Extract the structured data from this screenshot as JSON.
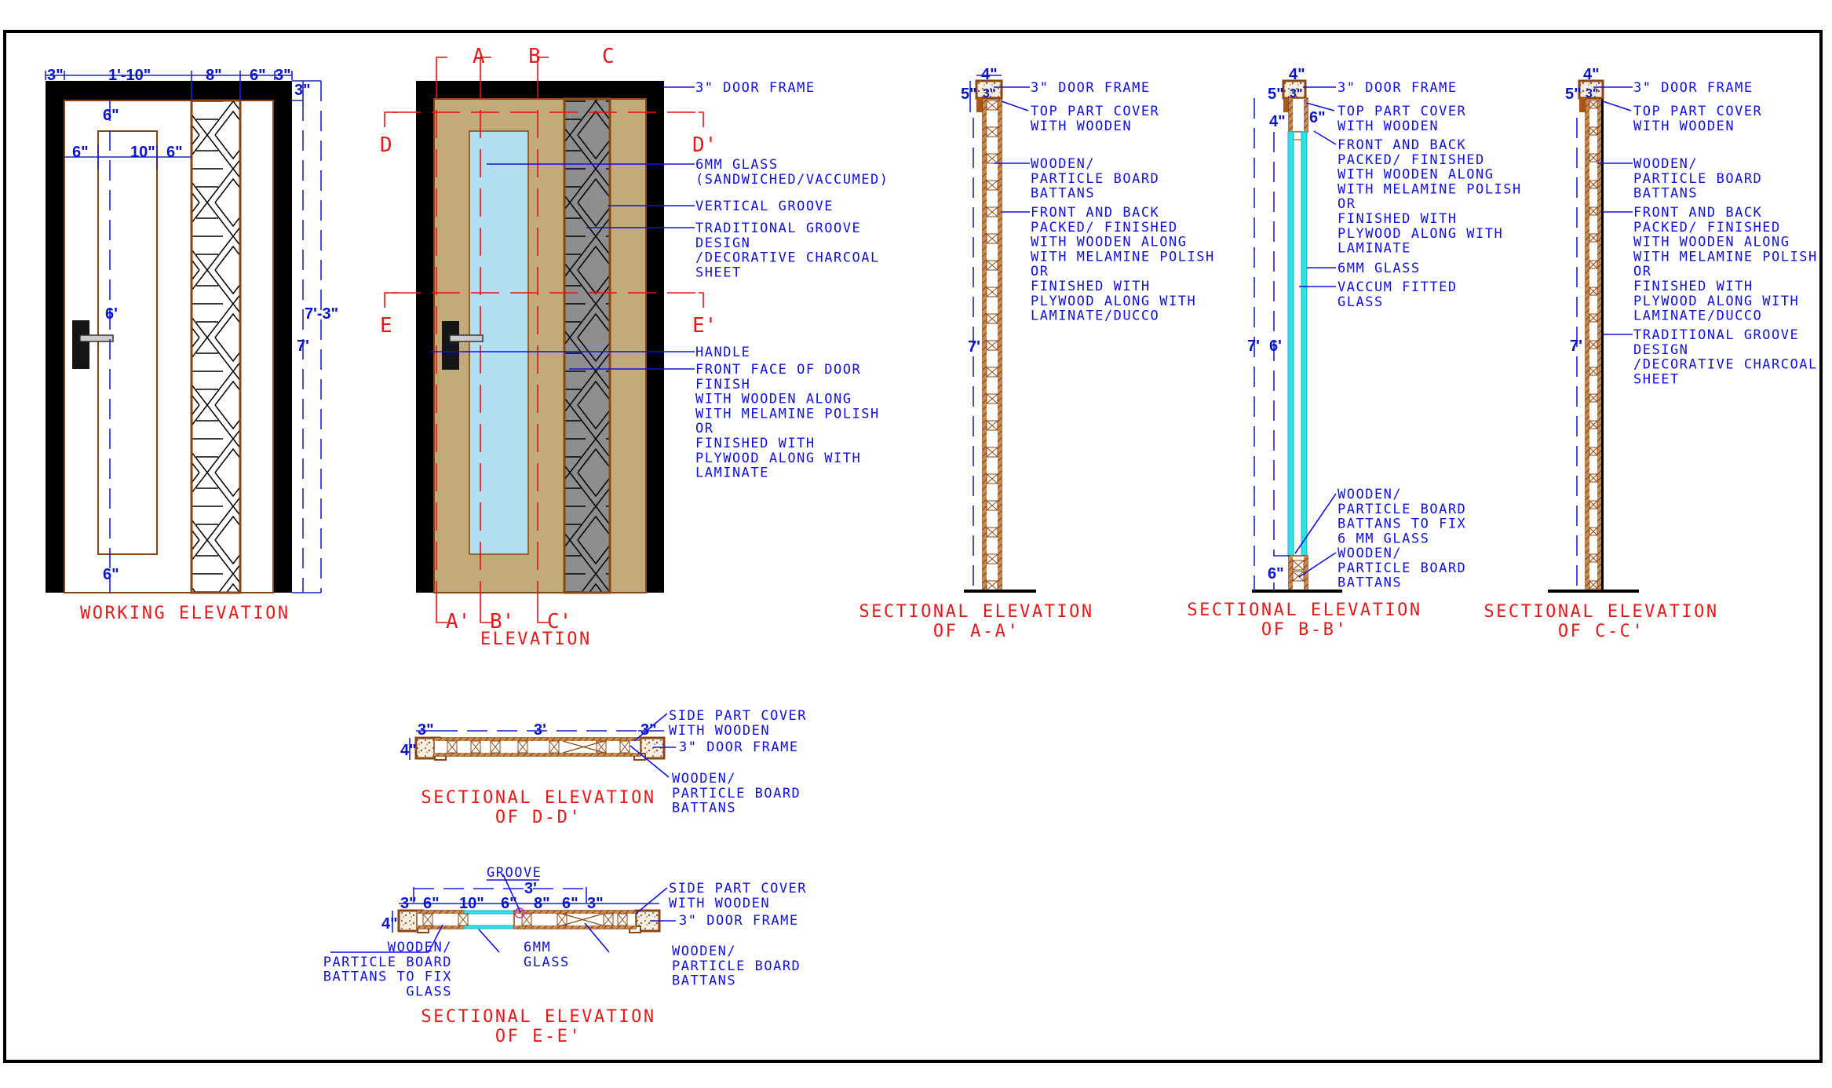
{
  "colors": {
    "frame": "#000000",
    "panel": "#c2ab78",
    "glass": "#b4dff2",
    "charcoal": "#8e8e8e",
    "wood": "#a8561a",
    "section_glass": "#33e0e8",
    "annotation": "#1010e0",
    "title": "#e81818"
  },
  "working_elevation": {
    "title": "WORKING ELEVATION",
    "dims_top": [
      "3\"",
      "1'-10\"",
      "8\"",
      "6\"",
      "3\""
    ],
    "dim_frame_top": "3\"",
    "dim_panel_top": "6\"",
    "dim_panel_row": [
      "6\"",
      "10\"",
      "6\""
    ],
    "dim_panel_height": "6'",
    "dim_panel_bottom": "6\"",
    "dim_overall": "7'-3\"",
    "dim_door": "7'"
  },
  "elevation": {
    "title": "ELEVATION",
    "cut_labels_top": [
      "A",
      "B",
      "C"
    ],
    "cut_labels_bottom": [
      "A'",
      "B'",
      "C'"
    ],
    "cut_labels_left": [
      "D",
      "E"
    ],
    "cut_labels_right": [
      "D'",
      "E'"
    ],
    "notes": {
      "door_frame": [
        "3\" DOOR FRAME"
      ],
      "glass": [
        "6MM GLASS",
        "(SANDWICHED/VACCUMED)"
      ],
      "vertical_groove": [
        "VERTICAL GROOVE"
      ],
      "traditional_groove": [
        "TRADITIONAL GROOVE",
        "DESIGN",
        "/DECORATIVE CHARCOAL",
        "SHEET"
      ],
      "handle": [
        "HANDLE"
      ],
      "front_face": [
        "FRONT FACE OF DOOR",
        "FINISH",
        "WITH WOODEN ALONG",
        "WITH MELAMINE POLISH",
        "OR",
        "FINISHED WITH",
        "PLYWOOD ALONG WITH",
        "LAMINATE"
      ]
    }
  },
  "section_aa": {
    "title": [
      "SECTIONAL ELEVATION",
      "OF A-A'"
    ],
    "dims": {
      "width": "4\"",
      "frame": "3\"",
      "frame_h": "5\"",
      "height": "7'"
    },
    "notes": {
      "door_frame": [
        "3\" DOOR FRAME"
      ],
      "top_cover": [
        "TOP PART COVER",
        "WITH WOODEN"
      ],
      "battans": [
        "WOODEN/",
        "PARTICLE BOARD",
        "BATTANS"
      ],
      "finish": [
        "FRONT AND BACK",
        "PACKED/ FINISHED",
        "WITH WOODEN ALONG",
        "WITH MELAMINE POLISH",
        "OR",
        "FINISHED WITH",
        "PLYWOOD ALONG WITH",
        "LAMINATE/DUCCO"
      ]
    }
  },
  "section_bb": {
    "title": [
      "SECTIONAL ELEVATION",
      "OF B-B'"
    ],
    "dims": {
      "width": "4\"",
      "frame": "3\"",
      "frame_h": "5\"",
      "top_rail": "4\"",
      "top_gap": "6\"",
      "height": "7'",
      "glass_h": "6'",
      "bottom": "6\""
    },
    "notes": {
      "door_frame": [
        "3\" DOOR FRAME"
      ],
      "top_cover": [
        "TOP PART COVER",
        "WITH WOODEN"
      ],
      "finish": [
        "FRONT AND BACK",
        "PACKED/ FINISHED",
        "WITH WOODEN ALONG",
        "WITH MELAMINE POLISH",
        "OR",
        "FINISHED WITH",
        "PLYWOOD ALONG WITH",
        "LAMINATE"
      ],
      "glass": [
        "6MM GLASS"
      ],
      "vacuum": [
        "VACCUM FITTED",
        "GLASS"
      ],
      "battans_fix": [
        "WOODEN/",
        "PARTICLE BOARD",
        "BATTANS TO FIX",
        "6 MM GLASS"
      ],
      "battans": [
        "WOODEN/",
        "PARTICLE BOARD",
        "BATTANS"
      ]
    }
  },
  "section_cc": {
    "title": [
      "SECTIONAL ELEVATION",
      "OF C-C'"
    ],
    "dims": {
      "width": "4\"",
      "frame": "3\"",
      "frame_h": "5\"",
      "height": "7'"
    },
    "notes": {
      "door_frame": [
        "3\" DOOR FRAME"
      ],
      "top_cover": [
        "TOP PART COVER",
        "WITH WOODEN"
      ],
      "battans": [
        "WOODEN/",
        "PARTICLE BOARD",
        "BATTANS"
      ],
      "finish": [
        "FRONT AND BACK",
        "PACKED/ FINISHED",
        "WITH WOODEN ALONG",
        "WITH MELAMINE POLISH",
        "OR",
        "FINISHED WITH",
        "PLYWOOD ALONG WITH",
        "LAMINATE/DUCCO"
      ],
      "groove": [
        "TRADITIONAL GROOVE",
        "DESIGN",
        "/DECORATIVE CHARCOAL",
        "SHEET"
      ]
    }
  },
  "section_dd": {
    "title": [
      "SECTIONAL ELEVATION",
      "OF D-D'"
    ],
    "dims": {
      "left": "3\"",
      "span": "3'",
      "right": "3\"",
      "thickness": "4\""
    },
    "notes": {
      "side_cover": [
        "SIDE PART COVER",
        "WITH WOODEN"
      ],
      "door_frame": [
        "3\" DOOR FRAME"
      ],
      "battans": [
        "WOODEN/",
        "PARTICLE BOARD",
        "BATTANS"
      ]
    }
  },
  "section_ee": {
    "title": [
      "SECTIONAL ELEVATION",
      "OF E-E'"
    ],
    "dims": {
      "span": "3'",
      "row": [
        "3\"",
        "6\"",
        "10\"",
        "6\"",
        "8\"",
        "6\"",
        "3\""
      ],
      "thickness": "4\""
    },
    "notes": {
      "groove": [
        "GROOVE"
      ],
      "side_cover": [
        "SIDE PART COVER",
        "WITH WOODEN"
      ],
      "door_frame": [
        "3\" DOOR FRAME"
      ],
      "battans_fix": [
        "WOODEN/",
        "PARTICLE BOARD",
        "BATTANS TO FIX",
        "GLASS"
      ],
      "glass": [
        "6MM",
        "GLASS"
      ],
      "battans": [
        "WOODEN/",
        "PARTICLE BOARD",
        "BATTANS"
      ]
    }
  }
}
